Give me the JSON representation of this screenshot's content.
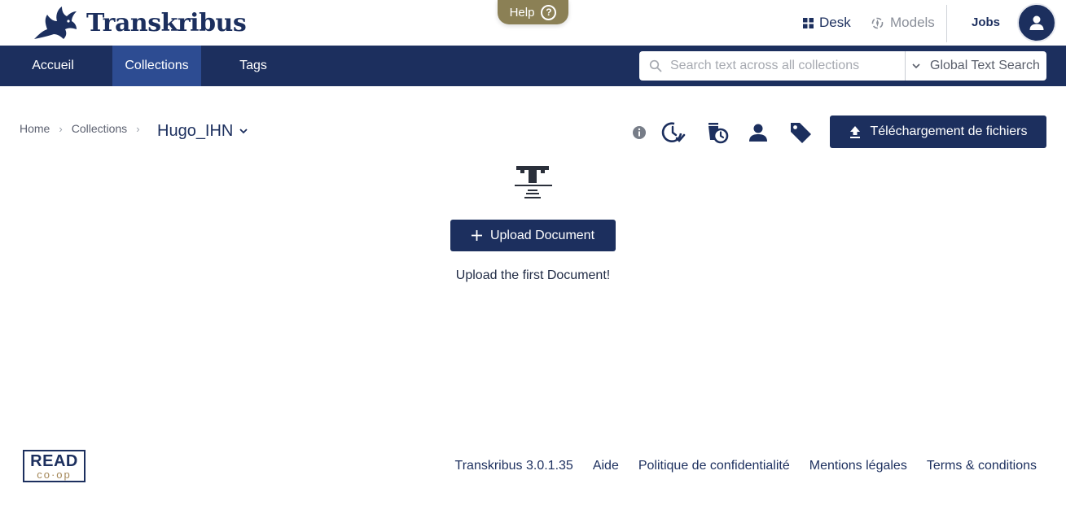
{
  "app": {
    "name": "Transkribus"
  },
  "help": {
    "label": "Help",
    "glyph": "?"
  },
  "top_nav": {
    "desk": "Desk",
    "models": "Models",
    "jobs": "Jobs"
  },
  "nav": {
    "items": [
      {
        "label": "Accueil",
        "active": false
      },
      {
        "label": "Collections",
        "active": true
      },
      {
        "label": "Tags",
        "active": false
      }
    ]
  },
  "search": {
    "placeholder": "Search text across all collections",
    "scope": "Global Text Search"
  },
  "breadcrumb": {
    "home": "Home",
    "collections": "Collections"
  },
  "collection": {
    "title": "Hugo_IHN"
  },
  "toolbar": {
    "upload_files": "Téléchargement de fichiers"
  },
  "empty_state": {
    "button": "Upload Document",
    "message": "Upload the first Document!"
  },
  "footer": {
    "logo_main": "READ",
    "logo_sub": "co·op",
    "links": [
      "Transkribus 3.0.1.35",
      "Aide",
      "Politique de confidentialité",
      "Mentions légales",
      "Terms & conditions"
    ]
  },
  "colors": {
    "primary": "#1c2f5e",
    "active_tab": "#2d4c92",
    "help_tab": "#8b8055",
    "logo_accent": "#a38656"
  }
}
